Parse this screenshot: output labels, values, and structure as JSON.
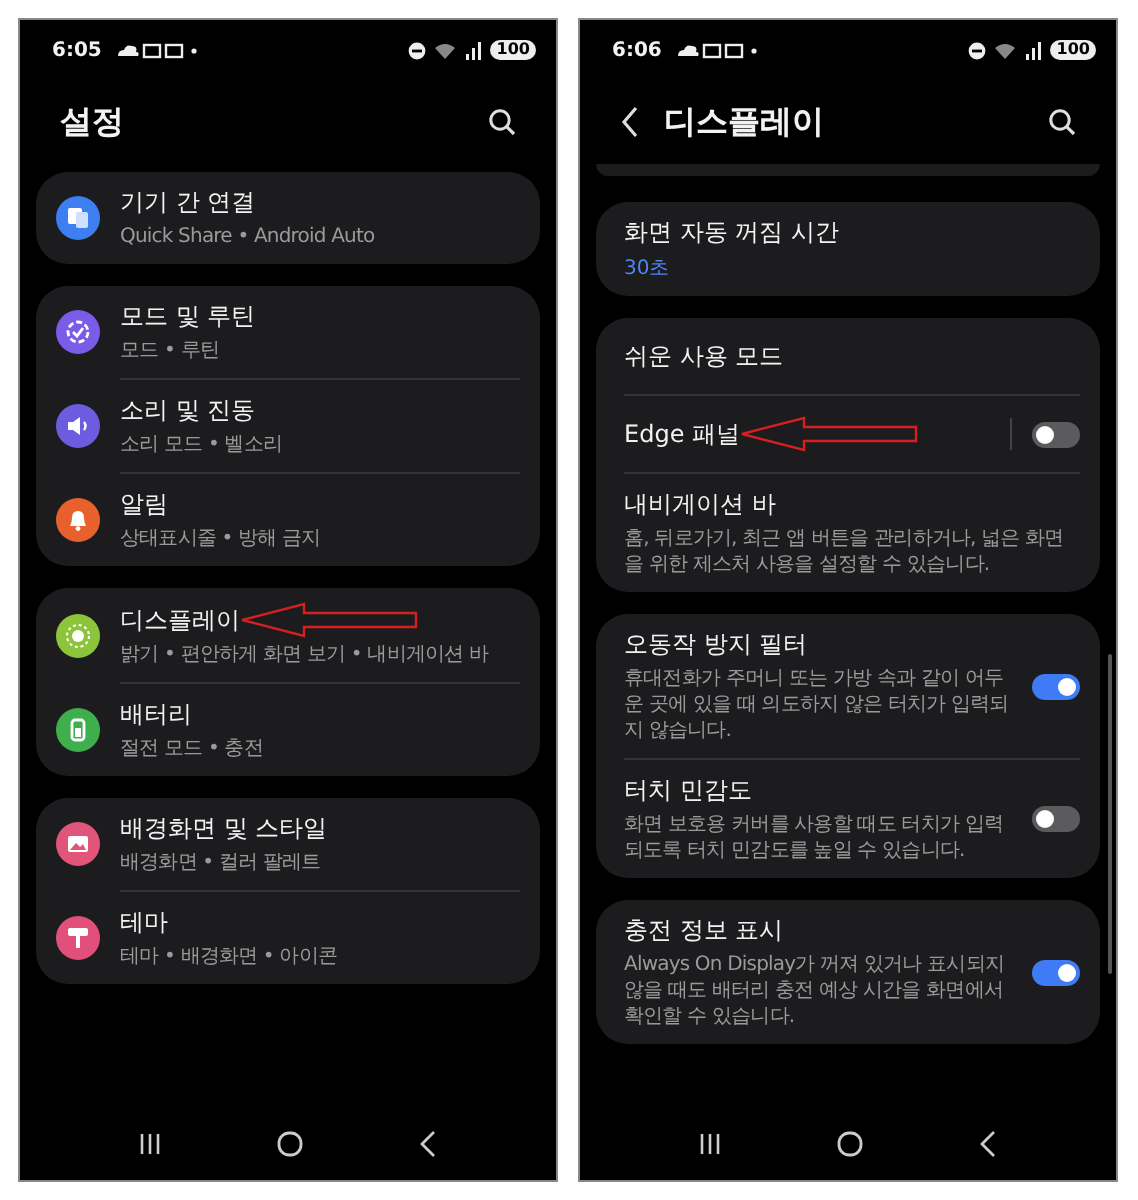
{
  "screens": [
    {
      "status_bar": {
        "time": "6:05",
        "battery": "100"
      },
      "title": "설정",
      "back": false,
      "scrolled": false,
      "groups": [
        {
          "items": [
            {
              "title": "기기 간 연결",
              "subtitle": "Quick Share  •  Android Auto",
              "color": "#3d7ef0",
              "annotated": false
            }
          ]
        },
        {
          "items": [
            {
              "title": "모드 및 루틴",
              "subtitle": "모드  •  루틴",
              "color": "#7a5ce8",
              "annotated": false
            },
            {
              "title": "소리 및 진동",
              "subtitle": "소리 모드  •  벨소리",
              "color": "#6d5ce0",
              "annotated": false
            },
            {
              "title": "알림",
              "subtitle": "상태표시줄  •  방해 금지",
              "color": "#e8612c",
              "annotated": false
            }
          ]
        },
        {
          "items": [
            {
              "title": "디스플레이",
              "subtitle": "밝기  •  편안하게 화면 보기  •  내비게이션 바",
              "color": "#8cc43c",
              "annotated": true
            },
            {
              "title": "배터리",
              "subtitle": "절전 모드  •  충전",
              "color": "#3fae4c",
              "annotated": false
            }
          ]
        },
        {
          "items": [
            {
              "title": "배경화면 및 스타일",
              "subtitle": "배경화면  •  컬러 팔레트",
              "color": "#e05579",
              "annotated": false
            },
            {
              "title": "테마",
              "subtitle": "테마  •  배경화면  •  아이콘",
              "color": "#e0507a",
              "annotated": false
            }
          ]
        }
      ]
    },
    {
      "status_bar": {
        "time": "6:06",
        "battery": "100"
      },
      "title": "디스플레이",
      "back": true,
      "scrolled": true,
      "groups": [
        {
          "items": [
            {
              "kind": "value",
              "title": "화면 자동 꺼짐 시간",
              "value": "30초",
              "annotated": false
            }
          ]
        },
        {
          "items": [
            {
              "kind": "plain",
              "title": "쉬운 사용 모드",
              "annotated": false
            },
            {
              "kind": "toggle",
              "title": "Edge 패널",
              "on": false,
              "annotated": true
            },
            {
              "kind": "plain",
              "title": "내비게이션 바",
              "subtitle": "홈, 뒤로가기, 최근 앱 버튼을 관리하거나, 넓은 화면을 위한 제스처 사용을 설정할 수 있습니다.",
              "annotated": false
            }
          ]
        },
        {
          "items": [
            {
              "kind": "toggle",
              "title": "오동작 방지 필터",
              "subtitle": "휴대전화가 주머니 또는 가방 속과 같이 어두운 곳에 있을 때 의도하지 않은 터치가 입력되지 않습니다.",
              "on": true,
              "annotated": false
            },
            {
              "kind": "toggle",
              "title": "터치 민감도",
              "subtitle": "화면 보호용 커버를 사용할 때도 터치가 입력되도록 터치 민감도를 높일 수 있습니다.",
              "on": false,
              "annotated": false
            }
          ]
        },
        {
          "items": [
            {
              "kind": "toggle",
              "title": "충전 정보 표시",
              "subtitle": "Always On Display가 꺼져 있거나 표시되지 않을 때도 배터리 충전 예상 시간을 화면에서 확인할 수 있습니다.",
              "on": true,
              "annotated": false
            }
          ]
        }
      ]
    }
  ]
}
